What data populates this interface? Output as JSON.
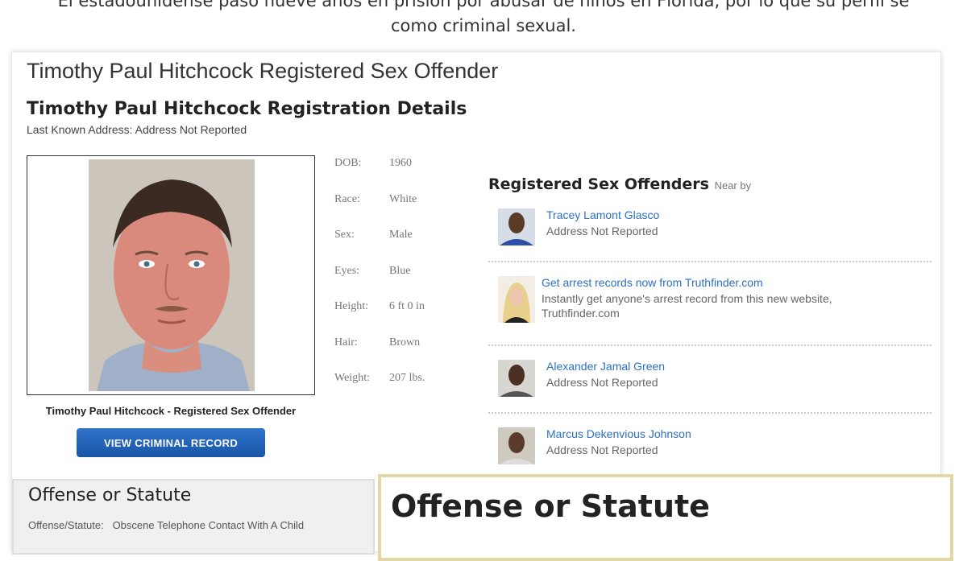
{
  "caption": {
    "line1": "El estadounidense pasó nueve años en prisión por abusar de niños en Florida, por lo que su perfil se",
    "line2": "como criminal sexual."
  },
  "page": {
    "title": "Timothy Paul Hitchcock Registered Sex Offender",
    "registration_title": "Timothy Paul Hitchcock Registration Details",
    "last_address": "Last Known Address: Address Not Reported"
  },
  "profile": {
    "photo_caption": "Timothy Paul Hitchcock - Registered Sex Offender",
    "view_button": "VIEW CRIMINAL RECORD",
    "details": [
      {
        "label": "DOB:",
        "value": "1960"
      },
      {
        "label": "Race:",
        "value": "White"
      },
      {
        "label": "Sex:",
        "value": "Male"
      },
      {
        "label": "Eyes:",
        "value": "Blue"
      },
      {
        "label": "Height:",
        "value": "6 ft 0 in"
      },
      {
        "label": "Hair:",
        "value": "Brown"
      },
      {
        "label": "Weight:",
        "value": "207 lbs."
      }
    ]
  },
  "nearby": {
    "title": "Registered Sex Offenders",
    "subtitle": "Near by",
    "items": [
      {
        "name": "Tracey Lamont Glasco",
        "sub": "Address Not Reported"
      },
      {
        "name": "Get arrest records now from Truthfinder.com",
        "sub": "Instantly get anyone's arrest record from this new website, Truthfinder.com"
      },
      {
        "name": "Alexander Jamal Green",
        "sub": "Address Not Reported"
      },
      {
        "name": "Marcus Dekenvious Johnson",
        "sub": "Address Not Reported"
      }
    ]
  },
  "offense": {
    "heading": "Offense or Statute",
    "label": "Offense/Statute:",
    "value": "Obscene Telephone Contact With A Child",
    "highlight_heading": "Offense or Statute"
  }
}
